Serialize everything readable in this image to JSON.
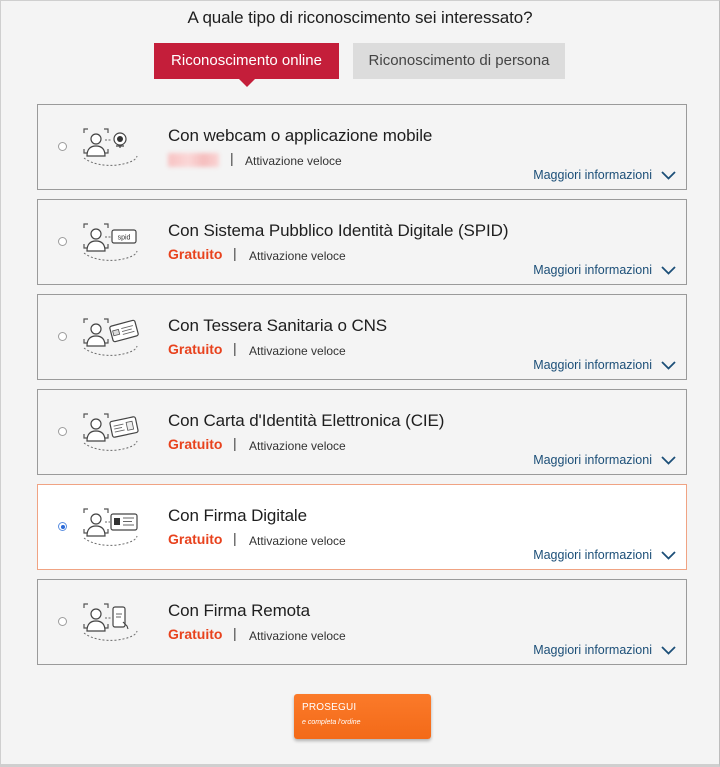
{
  "heading": "A quale tipo di riconoscimento sei interessato?",
  "tabs": [
    {
      "label": "Riconoscimento online",
      "active": true
    },
    {
      "label": "Riconoscimento di persona",
      "active": false
    }
  ],
  "options": [
    {
      "title": "Con webcam o applicazione mobile",
      "price": "",
      "speed": "Attivazione veloce",
      "more": "Maggiori informazioni",
      "icon": "webcam-icon",
      "selected": false
    },
    {
      "title": "Con Sistema Pubblico Identità Digitale (SPID)",
      "price": "Gratuito",
      "speed": "Attivazione veloce",
      "more": "Maggiori informazioni",
      "icon": "spid-icon",
      "badge": "spid",
      "selected": false
    },
    {
      "title": "Con Tessera Sanitaria o CNS",
      "price": "Gratuito",
      "speed": "Attivazione veloce",
      "more": "Maggiori informazioni",
      "icon": "health-card-icon",
      "selected": false
    },
    {
      "title": "Con Carta d'Identità Elettronica (CIE)",
      "price": "Gratuito",
      "speed": "Attivazione veloce",
      "more": "Maggiori informazioni",
      "icon": "id-card-icon",
      "selected": false
    },
    {
      "title": "Con Firma Digitale",
      "price": "Gratuito",
      "speed": "Attivazione veloce",
      "more": "Maggiori informazioni",
      "icon": "digital-signature-card-icon",
      "selected": true
    },
    {
      "title": "Con Firma Remota",
      "price": "Gratuito",
      "speed": "Attivazione veloce",
      "more": "Maggiori informazioni",
      "icon": "remote-signature-icon",
      "selected": false
    }
  ],
  "cta": {
    "label": "PROSEGUI",
    "sublabel": "e completa l'ordine"
  },
  "colors": {
    "accent": "#c41e3a",
    "price": "#e8421d",
    "link": "#1c4f78",
    "cta": "#f36a18",
    "selected_border": "#f0a383"
  }
}
